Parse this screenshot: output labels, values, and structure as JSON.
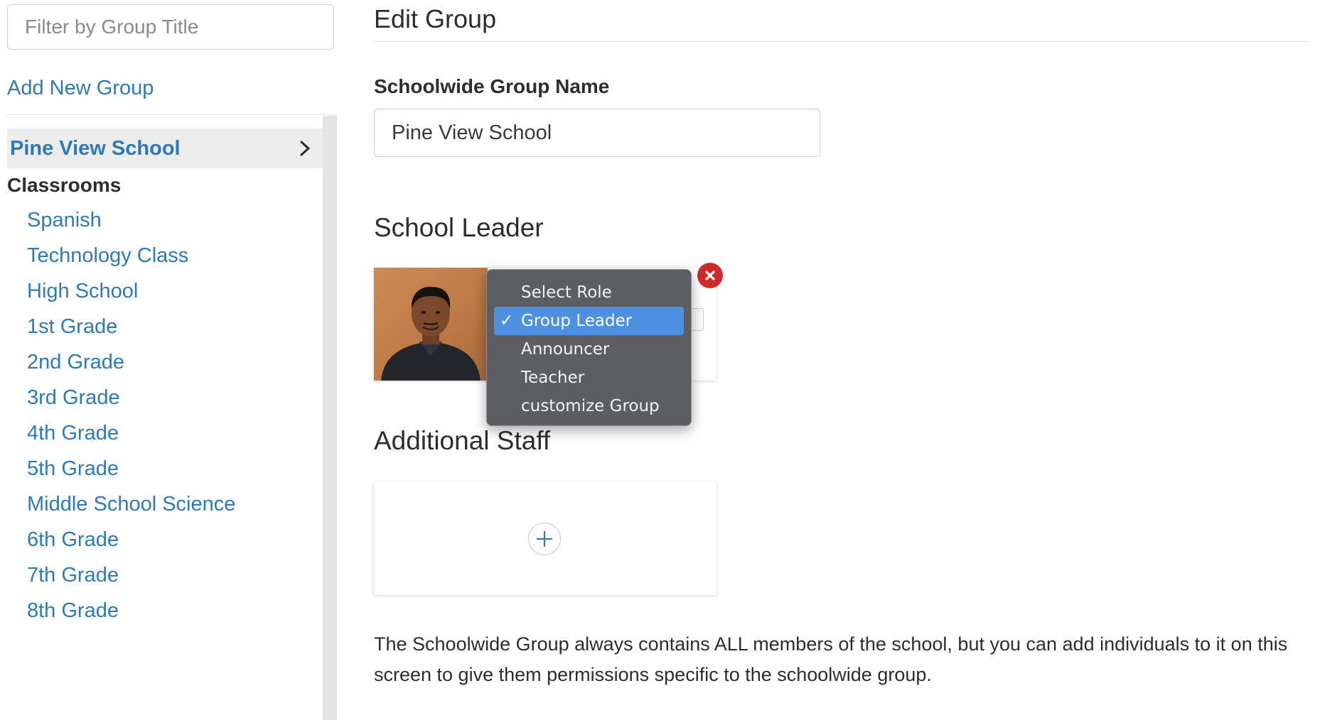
{
  "sidebar": {
    "filter": {
      "placeholder": "Filter by Group Title",
      "value": ""
    },
    "add_new_group": "Add New Group",
    "selected_school": "Pine View School",
    "section_heading": "Classrooms",
    "classrooms": [
      "Spanish",
      "Technology Class",
      "High School",
      "1st Grade",
      "2nd Grade",
      "3rd Grade",
      "4th Grade",
      "5th Grade",
      "Middle School Science",
      "6th Grade",
      "7th Grade",
      "8th Grade"
    ]
  },
  "main": {
    "title": "Edit Group",
    "group_name_label": "Schoolwide Group Name",
    "group_name_value": "Pine View School",
    "school_leader_title": "School Leader",
    "additional_staff_title": "Additional Staff",
    "info_text": "The Schoolwide Group always contains ALL members of the school, but you can add individuals to it on this screen to give them permissions specific to the schoolwide group."
  },
  "role_menu": {
    "options": [
      "Select Role",
      "Group Leader",
      "Announcer",
      "Teacher",
      "customize Group"
    ],
    "selected": "Group Leader",
    "check_mark": "✓"
  },
  "colors": {
    "link": "#2f79b8",
    "menu_bg": "#5d5e61",
    "menu_highlight": "#4d8fe0",
    "remove": "#cf2a27"
  },
  "icons": {
    "school_row": "chevron-right-icon",
    "remove": "close-circle-icon",
    "add_staff": "plus-icon"
  }
}
